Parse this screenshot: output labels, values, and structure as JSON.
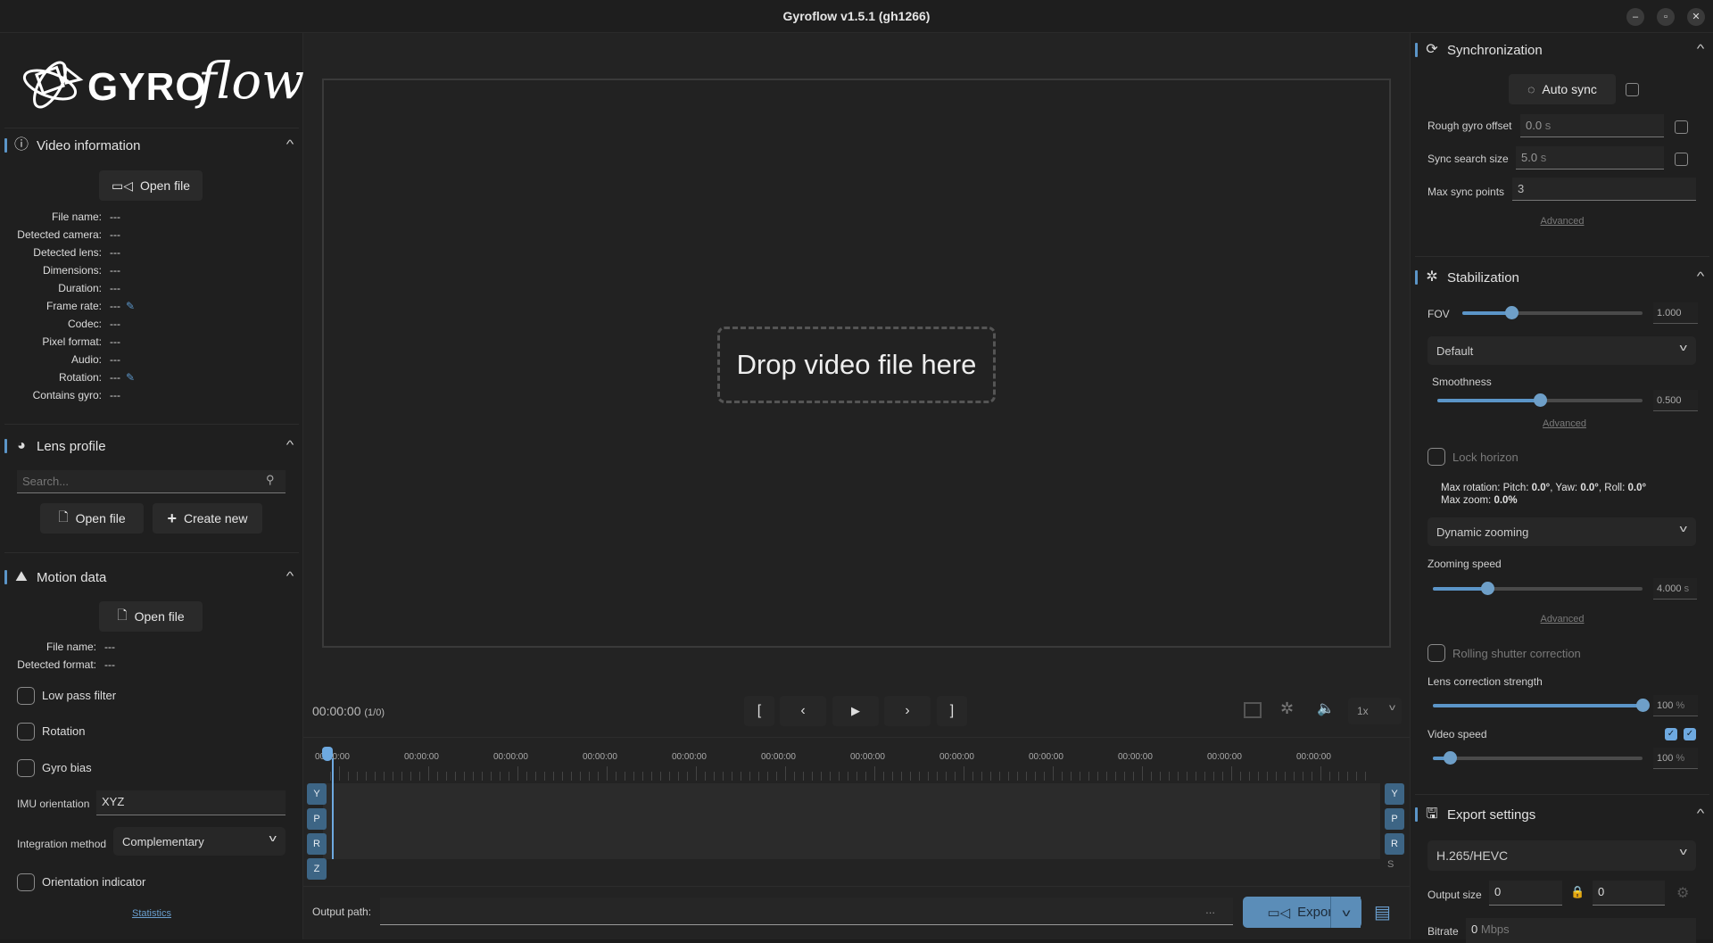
{
  "window": {
    "title": "Gyroflow v1.5.1 (gh1266)",
    "controls": [
      "minimize",
      "maximize",
      "close"
    ]
  },
  "logo": {
    "text_gyro": "GYRO",
    "text_flow": "flow"
  },
  "video_info": {
    "title": "Video information",
    "icon": "info-icon",
    "open_file": "Open file",
    "rows": [
      {
        "k": "File name:",
        "v": "---"
      },
      {
        "k": "Detected camera:",
        "v": "---"
      },
      {
        "k": "Detected lens:",
        "v": "---"
      },
      {
        "k": "Dimensions:",
        "v": "---"
      },
      {
        "k": "Duration:",
        "v": "---"
      },
      {
        "k": "Frame rate:",
        "v": "---",
        "editable": true
      },
      {
        "k": "Codec:",
        "v": "---"
      },
      {
        "k": "Pixel format:",
        "v": "---"
      },
      {
        "k": "Audio:",
        "v": "---"
      },
      {
        "k": "Rotation:",
        "v": "---",
        "editable": true
      },
      {
        "k": "Contains gyro:",
        "v": "---"
      }
    ]
  },
  "lens_profile": {
    "title": "Lens profile",
    "search_placeholder": "Search...",
    "open_file": "Open file",
    "create_new": "Create new"
  },
  "motion_data": {
    "title": "Motion data",
    "open_file": "Open file",
    "rows": [
      {
        "k": "File name:",
        "v": "---"
      },
      {
        "k": "Detected format:",
        "v": "---"
      }
    ],
    "low_pass": "Low pass filter",
    "rotation": "Rotation",
    "gyro_bias": "Gyro bias",
    "imu_label": "IMU orientation",
    "imu_value": "XYZ",
    "integration_label": "Integration method",
    "integration_value": "Complementary",
    "orientation_indicator": "Orientation indicator",
    "statistics": "Statistics"
  },
  "viewer": {
    "drop_text": "Drop video file here"
  },
  "playback": {
    "time": "00:00:00",
    "frame": "(1/0)",
    "speed": "1x"
  },
  "timeline": {
    "labels": [
      "00:00:00",
      "00:00:00",
      "00:00:00",
      "00:00:00",
      "00:00:00",
      "00:00:00",
      "00:00:00",
      "00:00:00",
      "00:00:00",
      "00:00:00",
      "00:00:00",
      "00:00:00"
    ],
    "left_axes": [
      "Y",
      "P",
      "R",
      "Z"
    ],
    "right_axes": [
      "Y",
      "P",
      "R"
    ],
    "right_extra": "S"
  },
  "output": {
    "label": "Output path:",
    "value": "",
    "browse": "...",
    "export": "Export"
  },
  "sync": {
    "title": "Synchronization",
    "auto_sync": "Auto sync",
    "rough_label": "Rough gyro offset",
    "rough_value": "0.0",
    "rough_unit": "s",
    "search_label": "Sync search size",
    "search_value": "5.0",
    "search_unit": "s",
    "max_label": "Max sync points",
    "max_value": "3",
    "advanced": "Advanced"
  },
  "stabilization": {
    "title": "Stabilization",
    "fov_label": "FOV",
    "fov_value": "1.000",
    "fov_fraction": 0.27,
    "method": "Default",
    "smoothness_label": "Smoothness",
    "smoothness_value": "0.500",
    "smoothness_fraction": 0.5,
    "advanced": "Advanced",
    "lock_horizon": "Lock horizon",
    "max_rot_prefix": "Max rotation: Pitch: ",
    "pitch": "0.0°",
    "yaw_prefix": ", Yaw: ",
    "yaw": "0.0°",
    "roll_prefix": ", Roll: ",
    "roll": "0.0°",
    "max_zoom_prefix": "Max zoom: ",
    "max_zoom": "0.0%",
    "zooming_mode": "Dynamic zooming",
    "zoom_speed_label": "Zooming speed",
    "zoom_speed_value": "4.000",
    "zoom_speed_unit": "s",
    "zoom_speed_fraction": 0.26,
    "advanced2": "Advanced",
    "rolling_shutter": "Rolling shutter correction",
    "lens_corr_label": "Lens correction strength",
    "lens_corr_value": "100",
    "lens_corr_unit": "%",
    "lens_corr_fraction": 1.0,
    "video_speed_label": "Video speed",
    "video_speed_value": "100",
    "video_speed_unit": "%",
    "video_speed_fraction": 0.08
  },
  "export": {
    "title": "Export settings",
    "codec": "H.265/HEVC",
    "size_label": "Output size",
    "width": "0",
    "height": "0",
    "bitrate_label": "Bitrate",
    "bitrate_value": "0",
    "bitrate_unit": "Mbps"
  },
  "colors": {
    "accent": "#5b95c8",
    "export_button": "#5b8db8",
    "axis_button": "#3d6585"
  }
}
